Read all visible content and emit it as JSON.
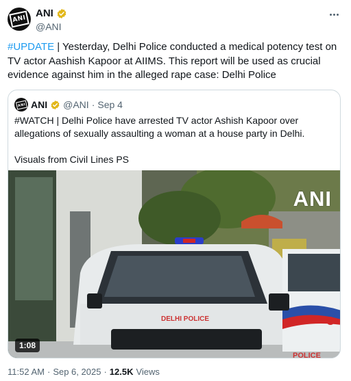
{
  "author": {
    "display_name": "ANI",
    "handle": "@ANI",
    "avatar_text": "ANI",
    "badge": "gold-verified-icon",
    "badge_color": "#e2b719"
  },
  "tweet": {
    "hashtag": "#UPDATE",
    "text": " | Yesterday, Delhi Police conducted a medical potency test on TV actor Aashish Kapoor at AIIMS. This report will be used as crucial evidence against him in the alleged rape case: Delhi Police"
  },
  "quote": {
    "display_name": "ANI",
    "handle": "@ANI",
    "separator": "·",
    "date": "Sep 4",
    "text_line1": "#WATCH | Delhi Police have arrested TV actor Ashish Kapoor over allegations of sexually assaulting a woman at a house party in Delhi.",
    "text_line2": "Visuals from Civil Lines PS",
    "video": {
      "duration": "1:08",
      "watermark": "ANI",
      "vehicle_text": "DELHI POLICE",
      "vehicle_text_side": "POLICE"
    }
  },
  "meta": {
    "time": "11:52 AM",
    "separator": "·",
    "date": "Sep 6, 2025",
    "separator2": "·",
    "views_count": "12.5K",
    "views_label": "Views"
  },
  "colors": {
    "link": "#1d9bf0",
    "secondary_text": "#536471",
    "border": "#cfd9de"
  }
}
